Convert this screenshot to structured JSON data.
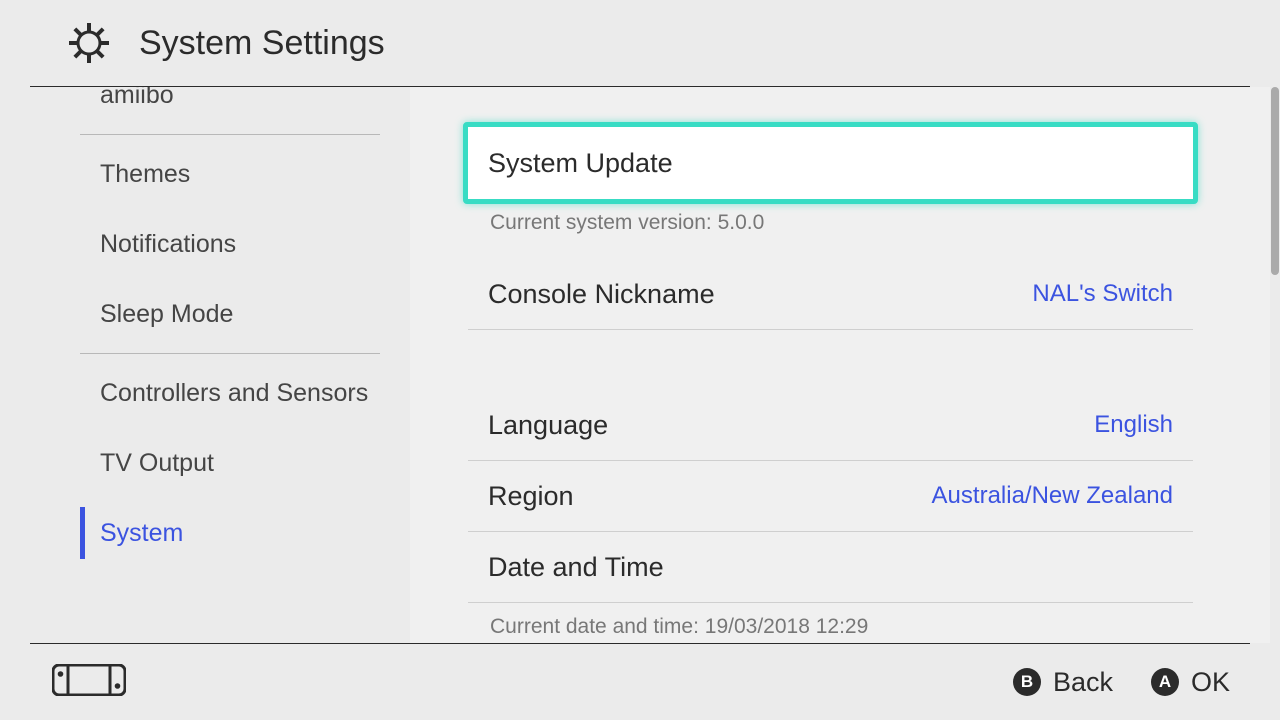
{
  "header": {
    "title": "System Settings"
  },
  "sidebar": {
    "items": [
      {
        "id": "amiibo",
        "label": "amiibo",
        "selected": false
      },
      {
        "id": "themes",
        "label": "Themes",
        "selected": false
      },
      {
        "id": "notifications",
        "label": "Notifications",
        "selected": false
      },
      {
        "id": "sleep-mode",
        "label": "Sleep Mode",
        "selected": false
      },
      {
        "id": "controllers-sensors",
        "label": "Controllers and Sensors",
        "selected": false
      },
      {
        "id": "tv-output",
        "label": "TV Output",
        "selected": false
      },
      {
        "id": "system",
        "label": "System",
        "selected": true
      }
    ]
  },
  "content": {
    "system_update": {
      "label": "System Update",
      "info": "Current system version: 5.0.0"
    },
    "console_nickname": {
      "label": "Console Nickname",
      "value": "NAL's Switch"
    },
    "language": {
      "label": "Language",
      "value": "English"
    },
    "region": {
      "label": "Region",
      "value": "Australia/New Zealand"
    },
    "date_time": {
      "label": "Date and Time",
      "info": "Current date and time: 19/03/2018 12:29"
    }
  },
  "footer": {
    "back": {
      "button": "B",
      "label": "Back"
    },
    "ok": {
      "button": "A",
      "label": "OK"
    }
  }
}
